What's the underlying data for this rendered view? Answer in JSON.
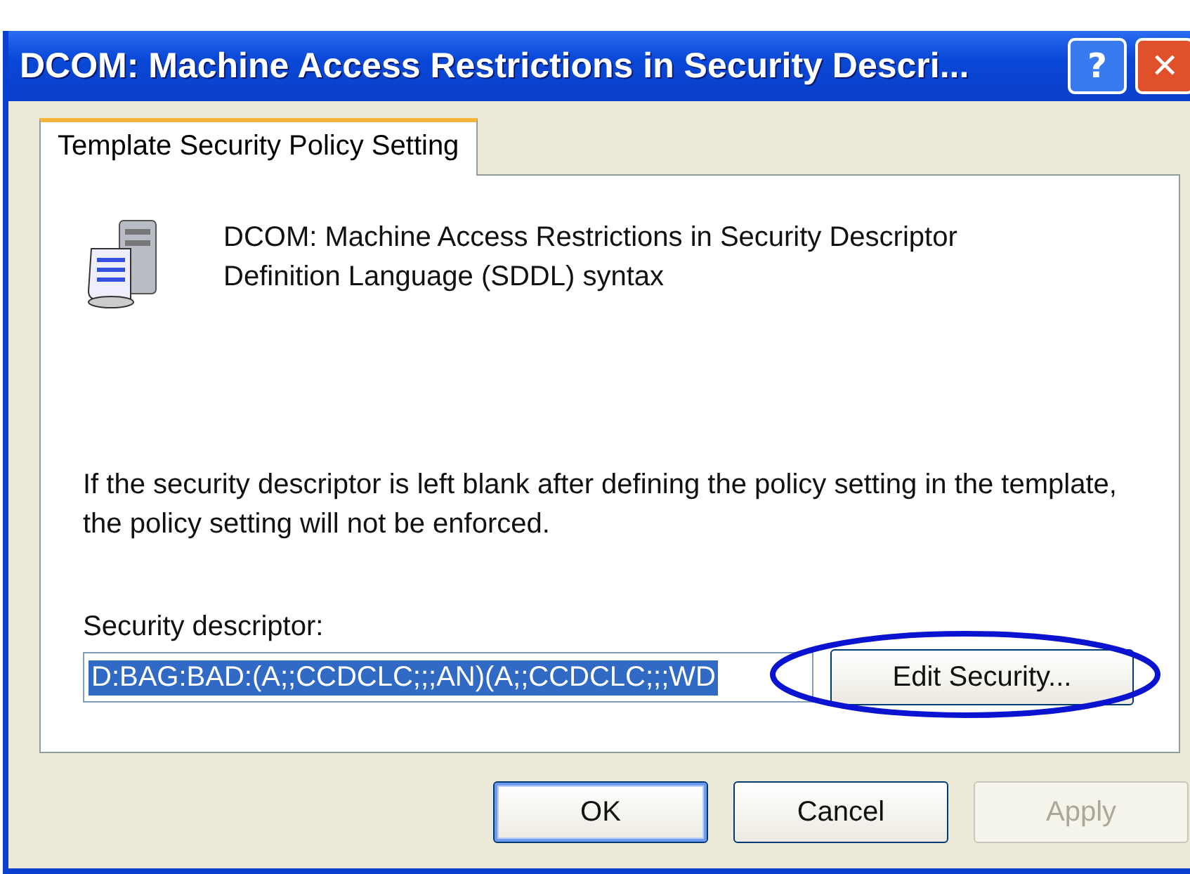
{
  "window": {
    "title": "DCOM: Machine Access Restrictions in Security Descri...",
    "title_buttons": [
      "?",
      "✕"
    ]
  },
  "tabs": [
    {
      "label": "Template Security Policy Setting",
      "selected": true
    }
  ],
  "header": {
    "text": "DCOM: Machine Access Restrictions in Security Descriptor Definition Language (SDDL) syntax"
  },
  "note": "If the security descriptor is left blank after defining the policy setting in the template, the policy setting will not be enforced.",
  "descriptor": {
    "label": "Security descriptor:",
    "value": "D:BAG:BAD:(A;;CCDCLC;;;AN)(A;;CCDCLC;;;WD",
    "selected": true
  },
  "edit_button": {
    "label": "Edit Security...",
    "highlighted": true
  },
  "buttons": [
    {
      "label": "OK",
      "default": true,
      "disabled": false
    },
    {
      "label": "Cancel",
      "default": false,
      "disabled": false
    },
    {
      "label": "Apply",
      "default": false,
      "disabled": true
    }
  ]
}
